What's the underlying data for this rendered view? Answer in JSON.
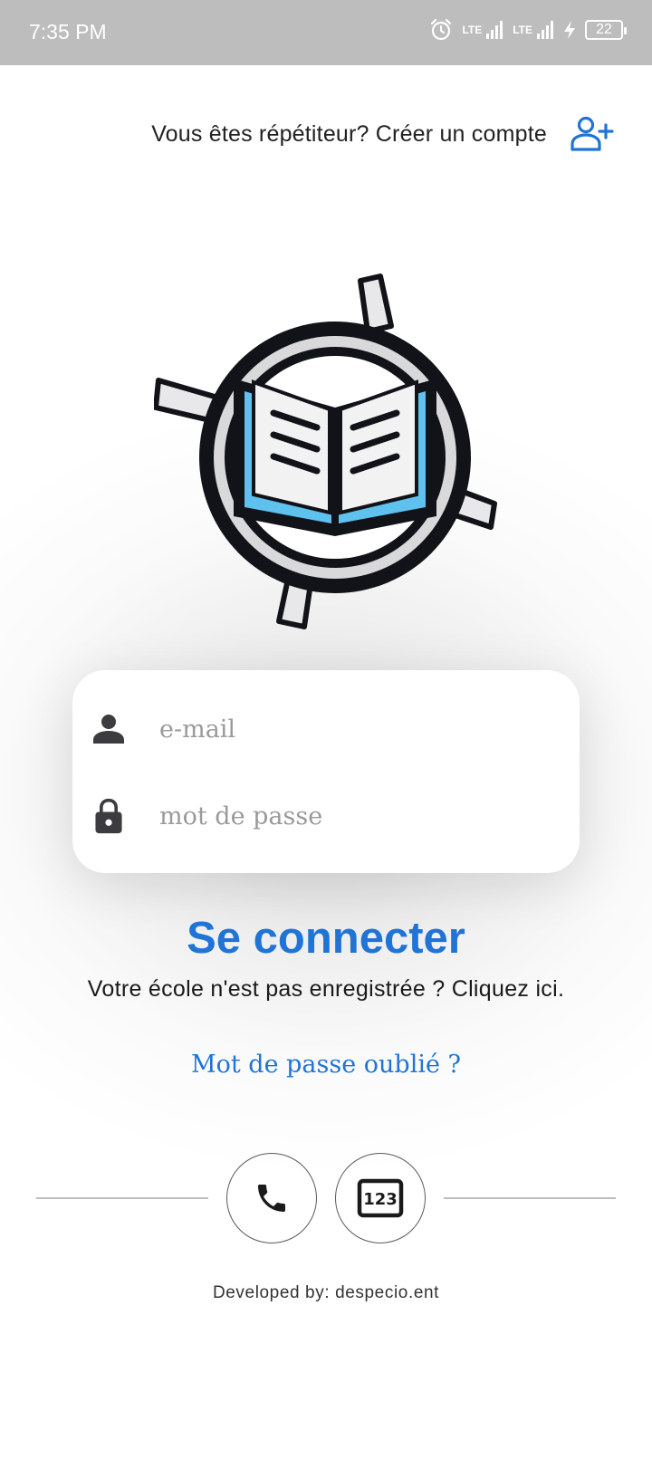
{
  "status_bar": {
    "time": "7:35 PM",
    "network_1": "LTE",
    "network_2": "LTE",
    "battery": "22",
    "icons": [
      "alarm-icon",
      "signal-icon",
      "signal-icon",
      "charging-icon",
      "battery-icon"
    ]
  },
  "header": {
    "signup_text": "Vous êtes répétiteur? Créer un compte",
    "signup_icon": "add-user-icon"
  },
  "login_form": {
    "email_placeholder": "e-mail",
    "email_value": "",
    "password_placeholder": "mot de passe",
    "password_value": "",
    "email_icon": "person-icon",
    "password_icon": "lock-icon"
  },
  "actions": {
    "login_label": "Se connecter",
    "school_link": "Votre école n'est pas enregistrée ? Cliquez ici.",
    "forgot_password": "Mot de passe oublié ?"
  },
  "bottom_buttons": {
    "phone_icon": "phone-icon",
    "code_icon": "numeric-keypad-icon"
  },
  "footer": {
    "credit": "Developed by: despecio.ent"
  },
  "colors": {
    "accent": "#1f74d6",
    "statusbar": "#bdbdbd",
    "icon_dark": "#3c3b40"
  }
}
